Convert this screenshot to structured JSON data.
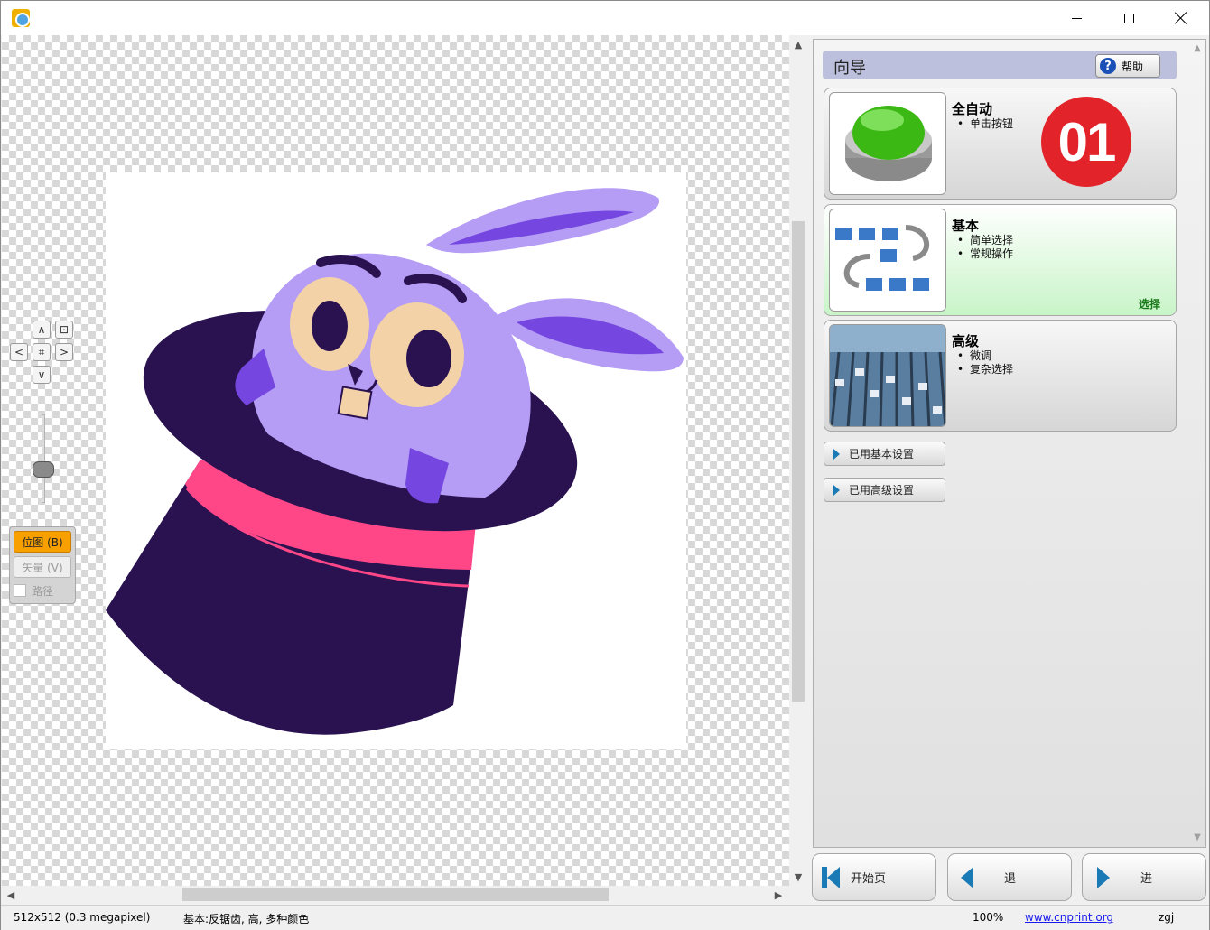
{
  "window": {
    "controls": {
      "minimize": "minimize-icon",
      "maximize": "maximize-icon",
      "close": "close-icon"
    }
  },
  "canvas": {
    "navigation": {
      "up": "∧",
      "fit": "⌗",
      "left": "<",
      "right": ">",
      "down": "∨",
      "zoom_fit": "zoom-fit-icon"
    },
    "mode_panel": {
      "bitmap_label": "位图 (B)",
      "vector_label": "矢量 (V)",
      "path_label": "路径"
    }
  },
  "wizard": {
    "title": "向导",
    "help_label": "帮助",
    "help_icon": "?",
    "cards": [
      {
        "title": "全自动",
        "bullets": [
          "单击按钮"
        ],
        "badge": "01"
      },
      {
        "title": "基本",
        "bullets": [
          "简单选择",
          "常规操作"
        ],
        "select_label": "选择"
      },
      {
        "title": "高级",
        "bullets": [
          "微调",
          "复杂选择"
        ]
      }
    ],
    "settings": {
      "basic_label": "已用基本设置",
      "advanced_label": "已用高级设置"
    },
    "nav": {
      "home_label": "开始页",
      "back_label": "退",
      "next_label": "进"
    }
  },
  "status": {
    "size": "512x512 (0.3 megapixel)",
    "mode": "基本:反锯齿, 高, 多种颜色",
    "zoom": "100%",
    "link": "www.cnprint.org",
    "user": "zgj"
  },
  "colors": {
    "accent": "#f7a000",
    "selected_card": "#c8f4c8",
    "badge": "#e3232a",
    "brand_blue": "#1a7ab5"
  }
}
